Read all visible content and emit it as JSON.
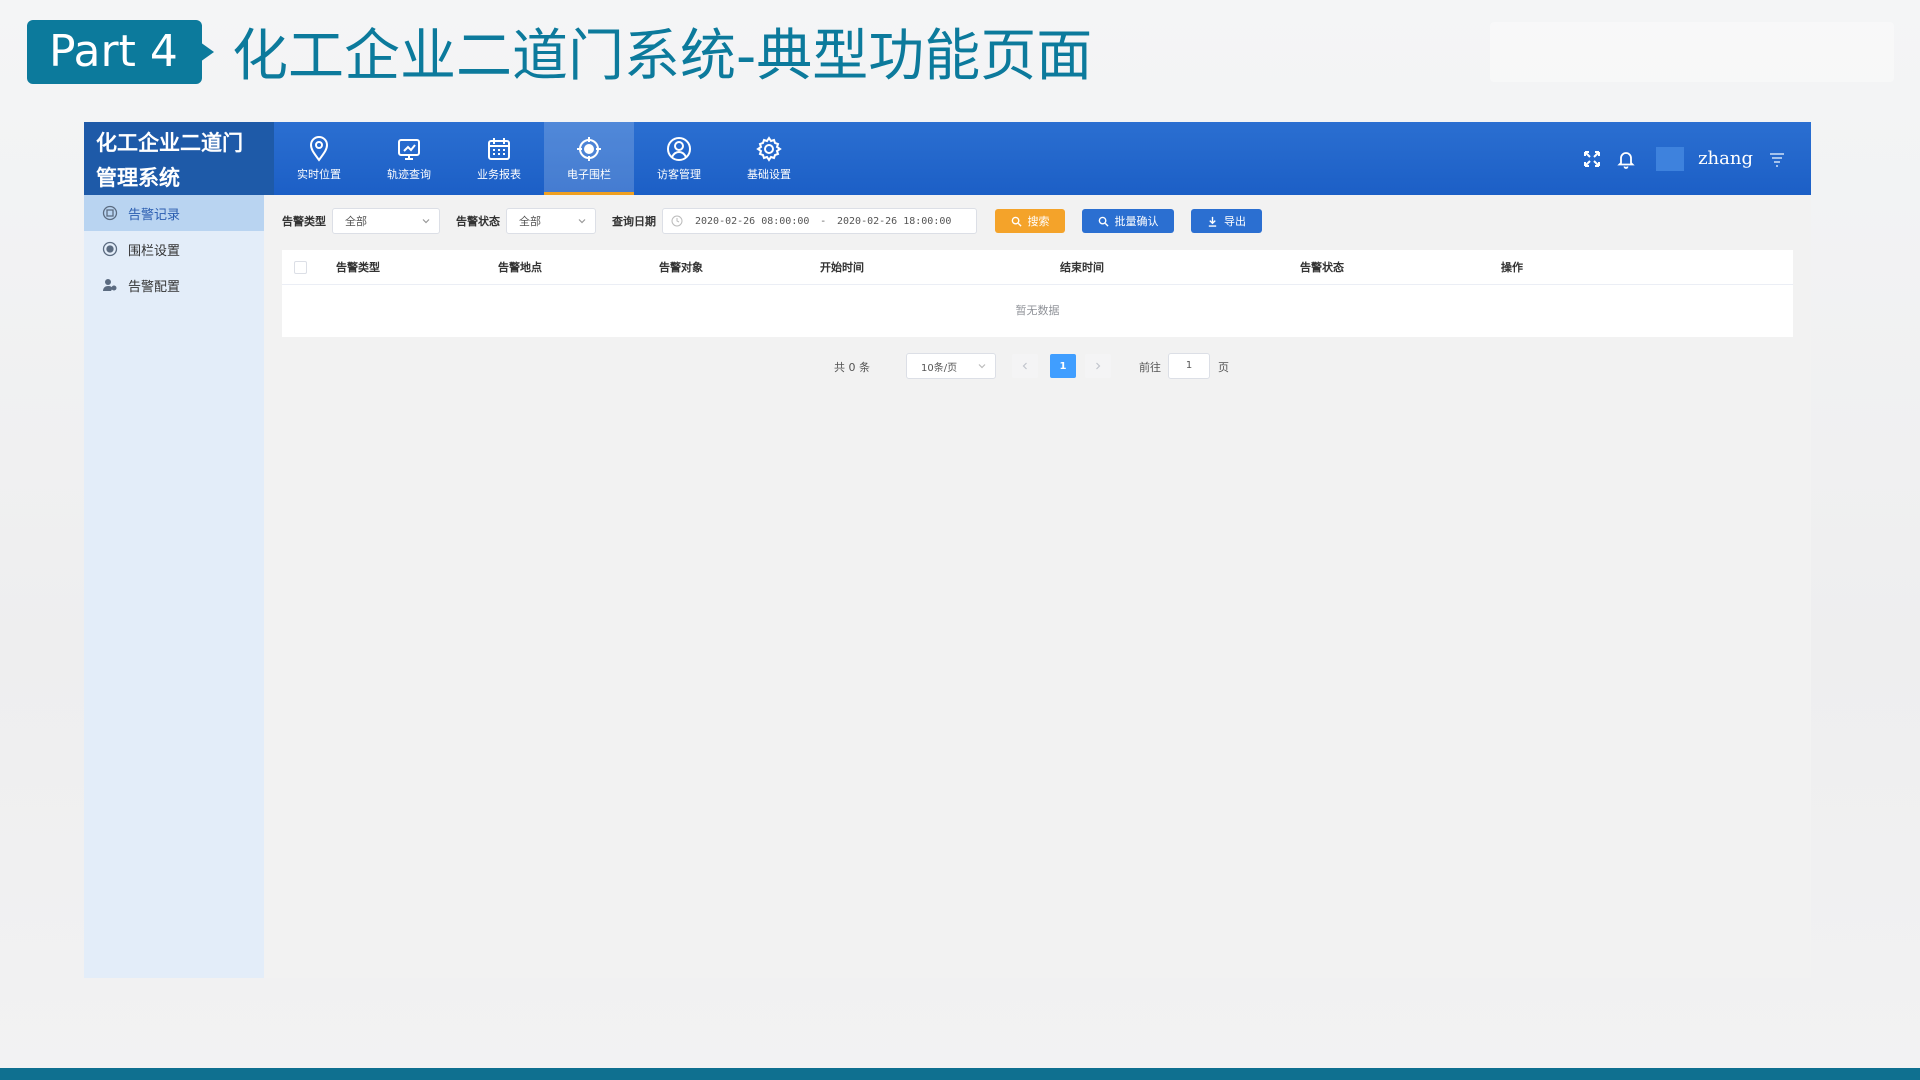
{
  "slide": {
    "badge": "Part 4",
    "title": "化工企业二道门系统-典型功能页面"
  },
  "app": {
    "logo_line1": "化工企业二道门",
    "logo_line2": "管理系统",
    "nav": [
      {
        "label": "实时位置",
        "icon": "location-pin-icon"
      },
      {
        "label": "轨迹查询",
        "icon": "track-monitor-icon"
      },
      {
        "label": "业务报表",
        "icon": "calendar-report-icon"
      },
      {
        "label": "电子围栏",
        "icon": "fence-target-icon",
        "active": true
      },
      {
        "label": "访客管理",
        "icon": "user-circle-icon"
      },
      {
        "label": "基础设置",
        "icon": "gear-icon"
      }
    ],
    "user": "zhang"
  },
  "sidebar": {
    "items": [
      {
        "label": "告警记录",
        "icon": "alarm-record-icon",
        "active": true
      },
      {
        "label": "围栏设置",
        "icon": "fence-setting-icon"
      },
      {
        "label": "告警配置",
        "icon": "alarm-config-icon"
      }
    ]
  },
  "filters": {
    "alarm_type_label": "告警类型",
    "alarm_type_value": "全部",
    "alarm_status_label": "告警状态",
    "alarm_status_value": "全部",
    "date_label": "查询日期",
    "date_start": "2020-02-26 08:00:00",
    "date_sep": "-",
    "date_end": "2020-02-26 18:00:00",
    "search_label": "搜索",
    "batch_label": "批量确认",
    "export_label": "导出"
  },
  "table": {
    "columns": [
      "告警类型",
      "告警地点",
      "告警对象",
      "开始时间",
      "结束时间",
      "告警状态",
      "操作"
    ],
    "empty_text": "暂无数据"
  },
  "pager": {
    "total": "共 0 条",
    "page_size": "10条/页",
    "current": "1",
    "goto_label": "前往",
    "goto_value": "1",
    "unit": "页"
  },
  "colors": {
    "header_blue": "#2b6fd1",
    "accent_orange": "#f4a32a",
    "slide_teal": "#0c7a9c",
    "page_active": "#409eff"
  }
}
